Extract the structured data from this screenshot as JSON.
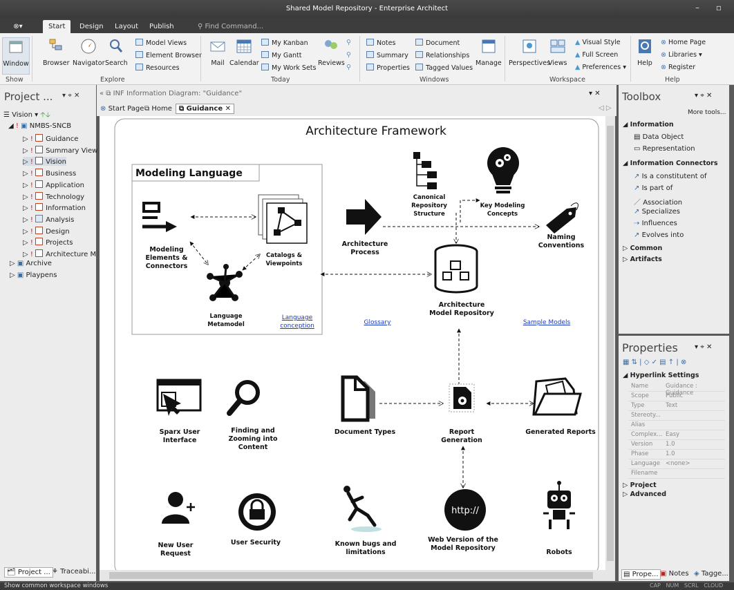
{
  "window": {
    "title": "Shared Model Repository - Enterprise Architect"
  },
  "ribbon_tabs": [
    "Start",
    "Design",
    "Layout",
    "Publish"
  ],
  "find_command": "Find Command...",
  "ribbon": {
    "show_group": {
      "window": "Window",
      "label": "Show"
    },
    "explore_group": {
      "browser": "Browser",
      "navigator": "Navigator",
      "search": "Search",
      "model_views": "Model Views",
      "element_browser": "Element Browser",
      "resources": "Resources",
      "label": "Explore"
    },
    "today_group": {
      "mail": "Mail",
      "calendar": "Calendar",
      "my_kanban": "My Kanban",
      "my_gantt": "My Gantt",
      "my_work_sets": "My Work Sets",
      "reviews": "Reviews",
      "label": "Today"
    },
    "windows_group": {
      "notes": "Notes",
      "summary": "Summary",
      "properties": "Properties",
      "document": "Document",
      "relationships": "Relationships",
      "tagged_values": "Tagged Values",
      "manage": "Manage",
      "label": "Windows"
    },
    "workspace_group": {
      "perspectives": "Perspectives",
      "views": "Views",
      "visual_style": "Visual Style",
      "full_screen": "Full Screen",
      "preferences": "Preferences",
      "label": "Workspace"
    },
    "help_group": {
      "help": "Help",
      "home_page": "Home Page",
      "libraries": "Libraries",
      "register": "Register",
      "label": "Help"
    }
  },
  "project_panel": {
    "title": "Project ...",
    "view_select": "Vision",
    "root": "NMBS-SNCB",
    "items": [
      "Guidance",
      "Summary View",
      "Vision",
      "Business",
      "Application",
      "Technology",
      "Information",
      "Analysis",
      "Design",
      "Projects",
      "Architecture M"
    ],
    "others": [
      "Archive",
      "Playpens"
    ],
    "bottom_tabs": [
      "Project ...",
      "Traceabi..."
    ]
  },
  "diagram_header": {
    "caption": "INF Information Diagram: \"Guidance\"",
    "tabs": [
      "Start Page",
      "Home",
      "Guidance"
    ]
  },
  "diagram": {
    "title": "Architecture Framework",
    "modeling_language": "Modeling Language",
    "labels": {
      "elements": "Modeling Elements & Connectors",
      "catalogs": "Catalogs & Viewpoints",
      "metamodel": "Language Metamodel",
      "canonical": "Canonical Repository Structure",
      "key_concepts": "Key Modeling Concepts",
      "naming": "Naming Conventions",
      "process": "Architecture Process",
      "repository": "Architecture Model Repository",
      "sparx_ui": "Sparx User Interface",
      "finding": "Finding and Zooming into Content",
      "doc_types": "Document Types",
      "report_gen": "Report Generation",
      "generated": "Generated Reports",
      "new_user": "New User Request",
      "user_security": "User Security",
      "known_bugs": "Known bugs and limitations",
      "web_version": "Web Version of the Model Repository",
      "robots": "Robots"
    },
    "links": {
      "language_conception": "Language conception",
      "glossary": "Glossary",
      "sample_models": "Sample Models"
    },
    "web_icon_text": "http://"
  },
  "toolbox": {
    "title": "Toolbox",
    "more_tools": "More tools...",
    "information_header": "Information",
    "information_items": [
      "Data Object",
      "Representation"
    ],
    "connectors_header": "Information Connectors",
    "connector_items": [
      "Is a constitutent of",
      "Is part of",
      "Association",
      "Specializes",
      "Influences",
      "Evolves into"
    ],
    "common": "Common",
    "artifacts": "Artifacts"
  },
  "properties": {
    "title": "Properties",
    "section": "Hyperlink Settings",
    "rows": [
      {
        "k": "Name",
        "v": "Guidance : Guidance"
      },
      {
        "k": "Scope",
        "v": "Public"
      },
      {
        "k": "Type",
        "v": "Text"
      },
      {
        "k": "Stereoty...",
        "v": ""
      },
      {
        "k": "Alias",
        "v": ""
      },
      {
        "k": "Complex...",
        "v": "Easy"
      },
      {
        "k": "Version",
        "v": "1.0"
      },
      {
        "k": "Phase",
        "v": "1.0"
      },
      {
        "k": "Language",
        "v": "<none>"
      },
      {
        "k": "Filename",
        "v": ""
      }
    ],
    "project": "Project",
    "advanced": "Advanced",
    "bottom_tabs": [
      "Prope...",
      "Notes",
      "Tagge..."
    ]
  },
  "statusbar": {
    "text": "Show common workspace windows",
    "indicators": [
      "CAP",
      "NUM",
      "SCRL",
      "CLOUD"
    ]
  }
}
